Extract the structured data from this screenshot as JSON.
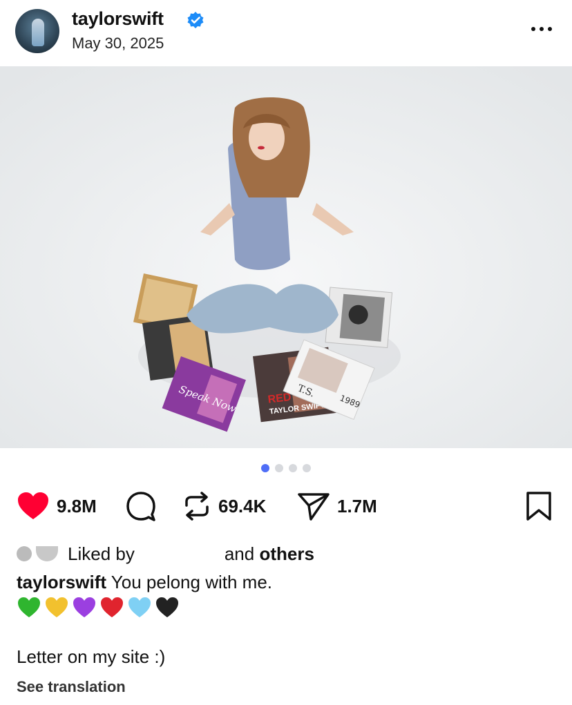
{
  "post": {
    "username": "taylorswift",
    "date": "May 30, 2025",
    "verified": true
  },
  "carousel": {
    "count": 4,
    "active_index": 0
  },
  "photo": {
    "album_labels": [
      "RED",
      "TAYLOR SWIFT",
      "T.S.",
      "1989",
      "Speak Now"
    ]
  },
  "actions": {
    "likes": "9.8M",
    "reposts": "69.4K",
    "shares": "1.7M"
  },
  "liked_by": {
    "prefix": "Liked by",
    "suffix": "and",
    "others": "others"
  },
  "caption": {
    "username": "taylorswift",
    "text": "You pelong with me.",
    "hearts": [
      "#2fb52f",
      "#f2c12e",
      "#9b3fe0",
      "#e0242e",
      "#7fd0f4",
      "#222222"
    ],
    "letter": "Letter on my site :)",
    "see_translation": "See translation"
  },
  "colors": {
    "like_red": "#ff0033",
    "verified_blue": "#1d8cf8",
    "dot_active": "#4f6ef7"
  }
}
